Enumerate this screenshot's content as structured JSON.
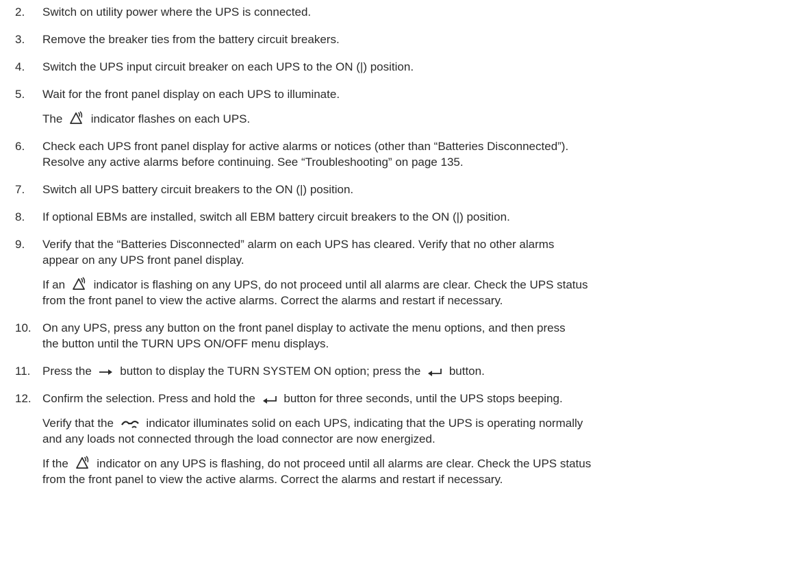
{
  "steps": [
    {
      "number": "2.",
      "text": "Switch on utility power where the UPS is connected."
    },
    {
      "number": "3.",
      "text": "Remove the breaker ties from the battery circuit breakers."
    },
    {
      "number": "4.",
      "text": "Switch the UPS input circuit breaker on each UPS to the ON (|) position."
    },
    {
      "number": "5.",
      "text": "Wait for the front panel display on each UPS to illuminate.",
      "note_before_icon": "The",
      "note_after_icon": "indicator flashes on each UPS."
    },
    {
      "number": "6.",
      "line1": "Check each UPS front panel display for active alarms or notices (other than “Batteries Disconnected”).",
      "line2": "Resolve any active alarms before continuing. See “Troubleshooting” on page 135."
    },
    {
      "number": "7.",
      "text": "Switch all UPS battery circuit breakers to the ON (|) position."
    },
    {
      "number": "8.",
      "text": "If optional EBMs are installed, switch all EBM battery circuit breakers to the ON (|) position."
    },
    {
      "number": "9.",
      "line1": "Verify that the “Batteries Disconnected” alarm on each UPS has cleared. Verify that no other alarms",
      "line2": "appear on any UPS front panel display.",
      "note_before_icon": "If an",
      "note_after_icon": "indicator is flashing on any UPS, do not proceed until all alarms are clear. Check the UPS status",
      "note_line2": "from the front panel to view the active alarms. Correct the alarms and restart if necessary."
    },
    {
      "number": "10.",
      "line1": "On any UPS, press any button on the front panel display to activate the menu options, and then press",
      "line2": "the  button until the TURN UPS ON/OFF menu displays."
    },
    {
      "number": "11.",
      "part1": "Press the",
      "part2": "button to display the TURN SYSTEM ON option; press the",
      "part3": "button."
    },
    {
      "number": "12.",
      "part1": "Confirm the selection. Press and hold the",
      "part2": "button for three seconds, until the UPS stops beeping.",
      "note1_before_icon": "Verify that the",
      "note1_after_icon": "indicator illuminates solid on each UPS, indicating that the UPS is operating normally",
      "note1_line2": "and any loads not connected through the load connector are now energized.",
      "note2_before_icon": "If the",
      "note2_after_icon": "indicator on any UPS is flashing, do not proceed until all alarms are clear. Check the UPS status",
      "note2_line2": "from the front panel to view the active alarms. Correct the alarms and restart if necessary."
    }
  ],
  "icons": {
    "alarm": "alarm-indicator-icon",
    "arrow_right": "right-arrow-icon",
    "enter": "enter-arrow-icon",
    "online": "online-indicator-icon"
  }
}
